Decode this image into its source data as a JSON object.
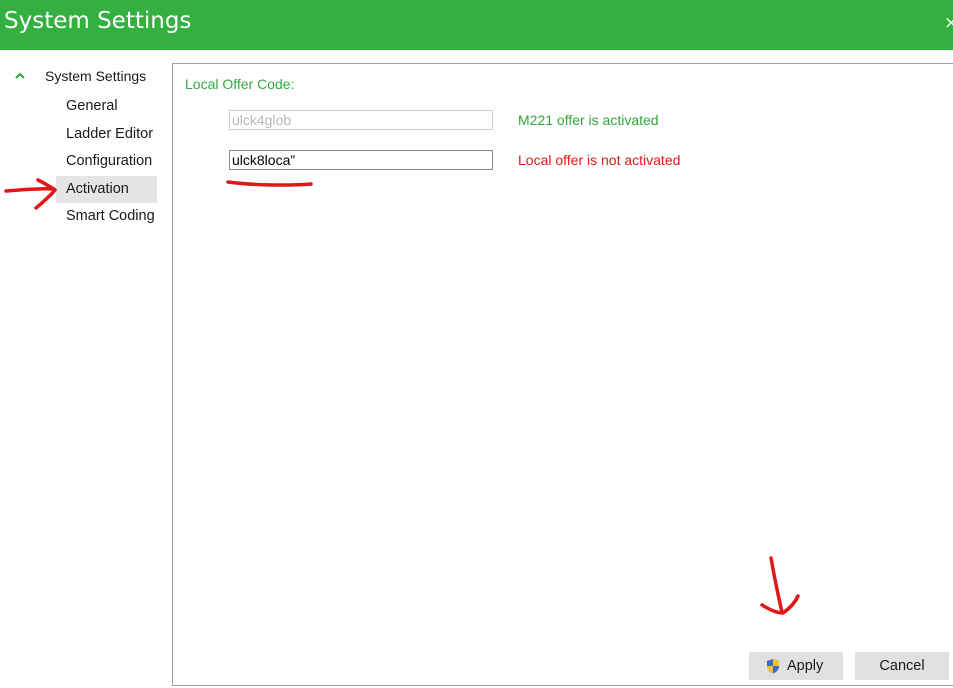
{
  "window": {
    "title": "System Settings",
    "close_glyph": "×"
  },
  "tree": {
    "root_label": "System Settings",
    "root_icon": "chevron-up-icon",
    "items": [
      {
        "label": "General"
      },
      {
        "label": "Ladder Editor"
      },
      {
        "label": "Configuration"
      },
      {
        "label": "Activation",
        "selected": true
      },
      {
        "label": "Smart Coding"
      }
    ]
  },
  "activation": {
    "section_label": "Local Offer Code:",
    "codes": [
      {
        "value": "ulck4glob",
        "status": "M221 offer is activated",
        "enabled": false
      },
      {
        "value": "ulck8loca”",
        "status": "Local offer is not activated",
        "enabled": true
      }
    ]
  },
  "footer": {
    "apply_label": "Apply",
    "apply_icon": "uac-shield-icon",
    "cancel_label": "Cancel"
  },
  "colors": {
    "titlebar": "#33b040",
    "activated": "#2fa83a",
    "not_activated": "#e01818",
    "annotation": "#e01818"
  }
}
